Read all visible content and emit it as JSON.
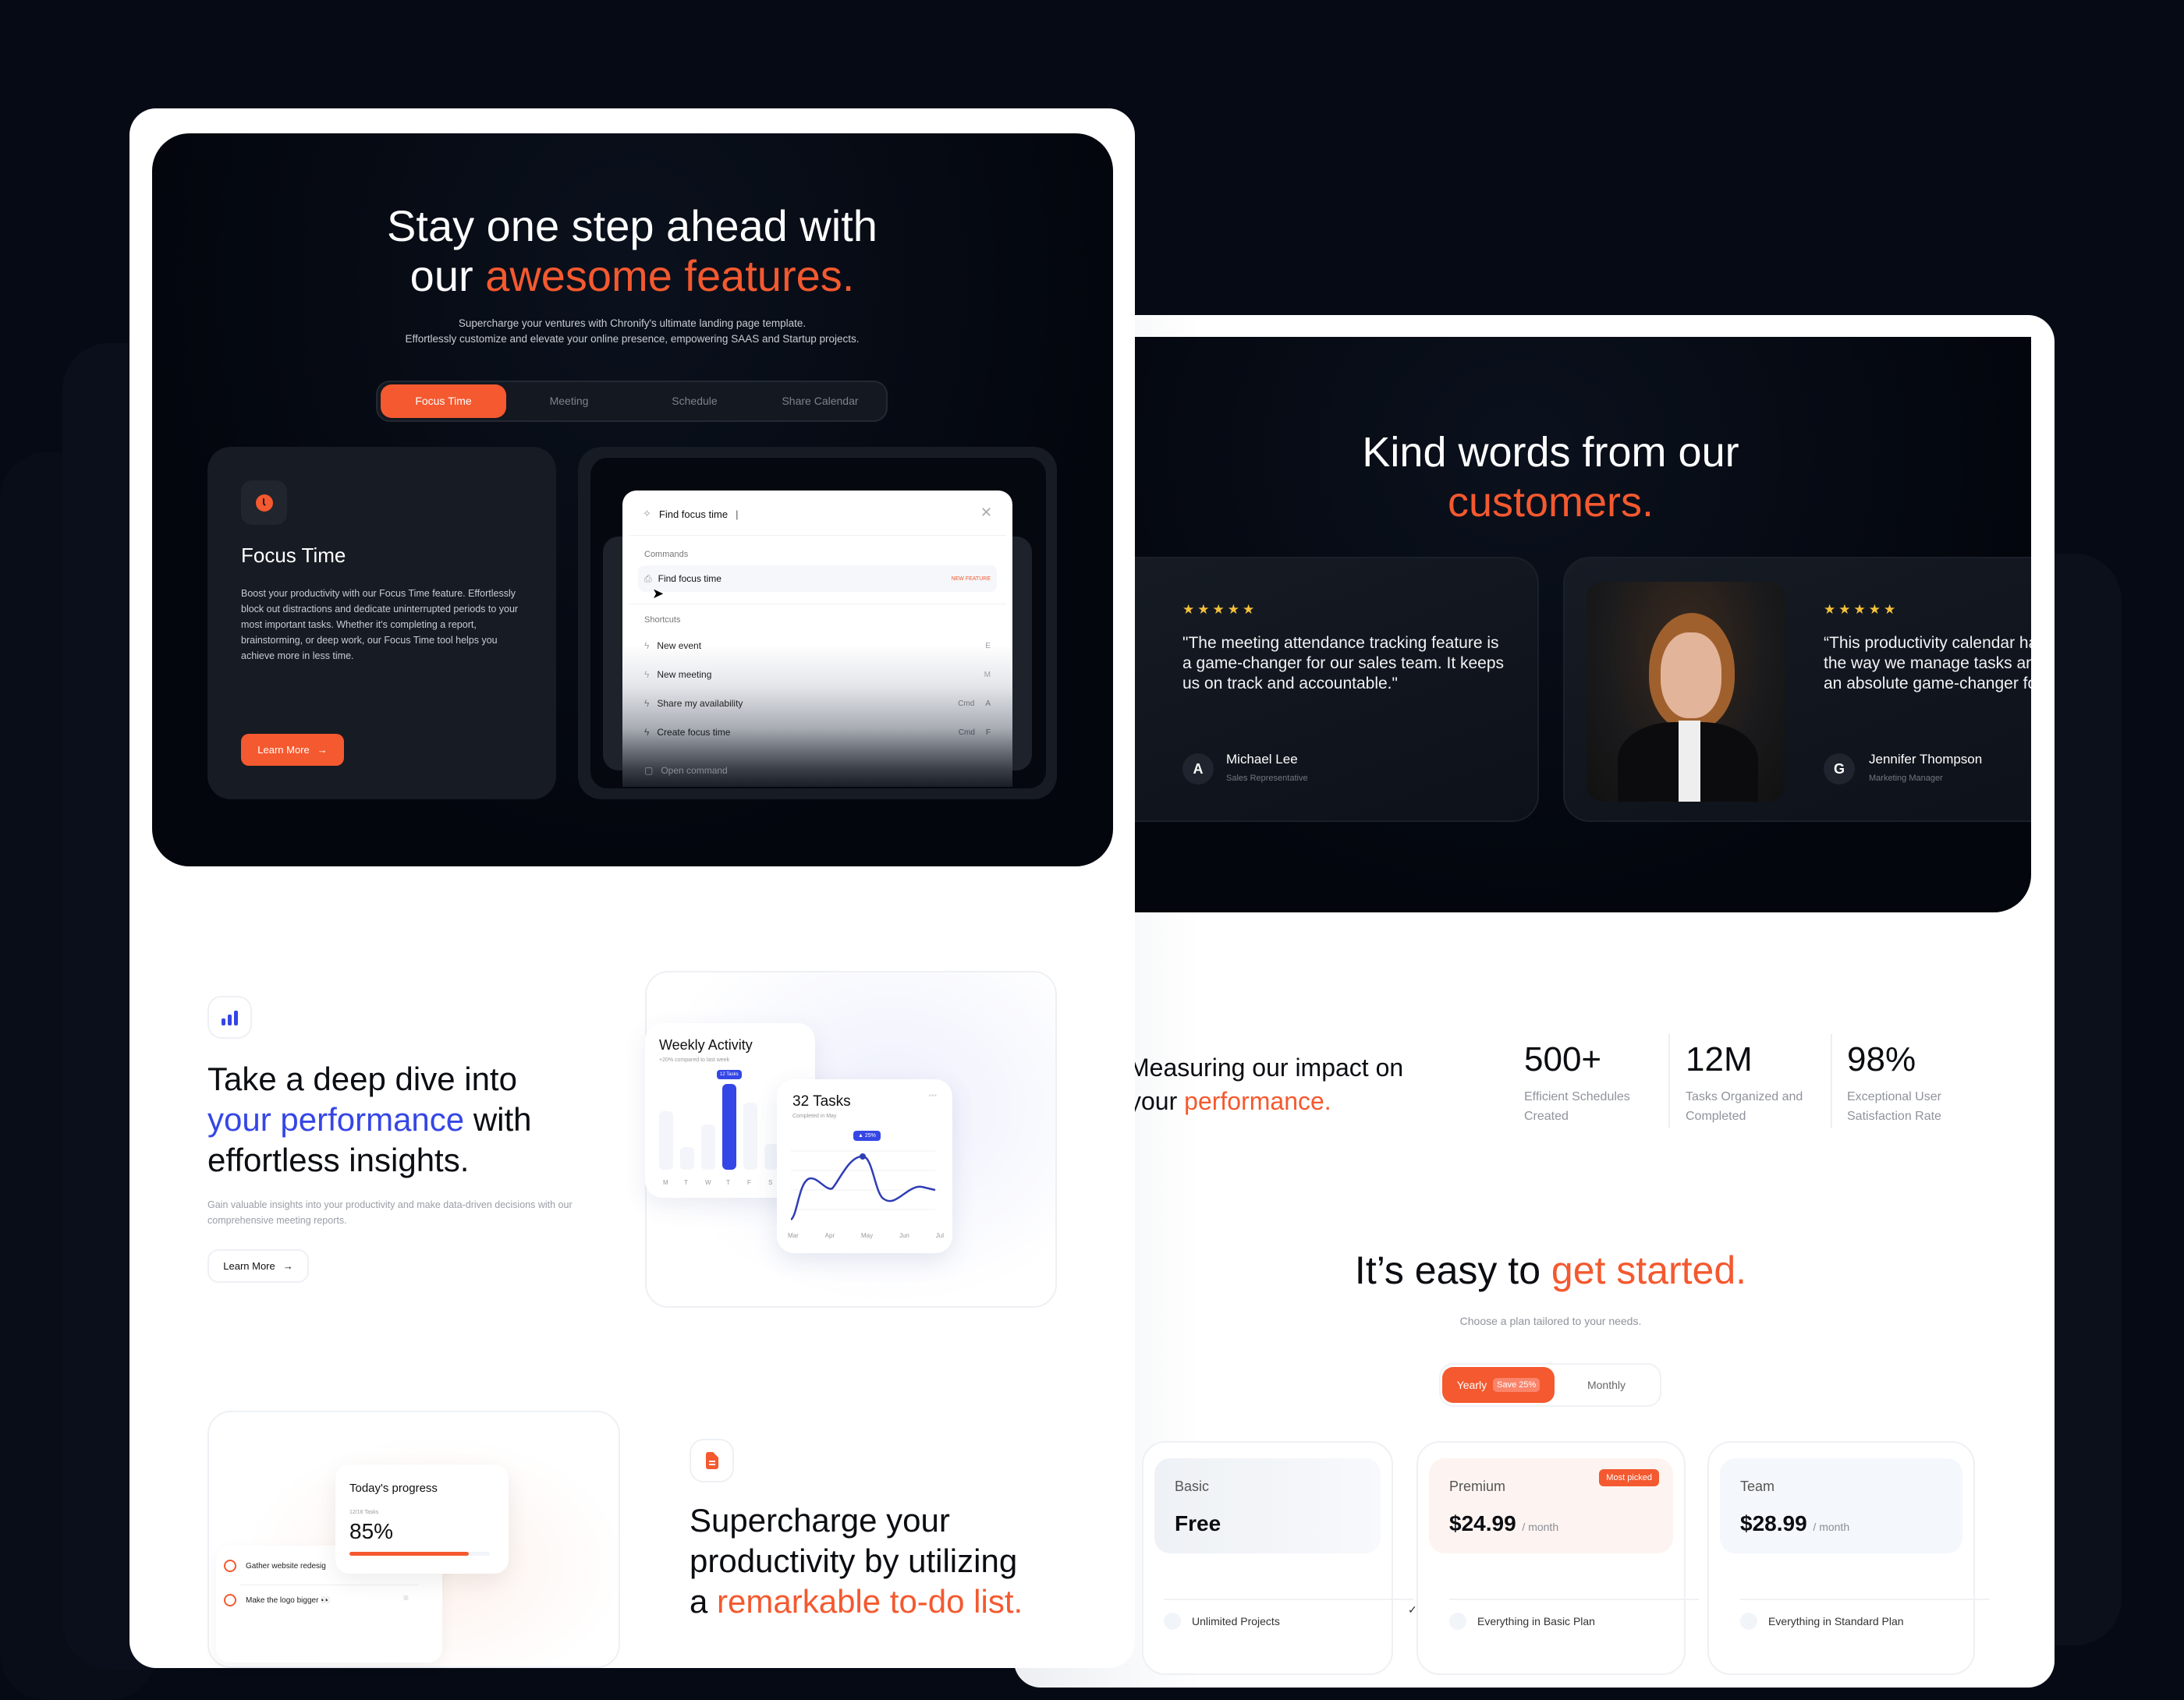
{
  "colors": {
    "accent": "#f4592f",
    "blue": "#3546e6",
    "background": "#050a15"
  },
  "hero": {
    "title_line1": "Stay one step ahead with",
    "title_line2_plain": "our ",
    "title_line2_accent": "awesome features.",
    "subtitle_line1": "Supercharge your ventures with Chronify's ultimate landing page template.",
    "subtitle_line2": "Effortlessly customize and elevate your online presence, empowering SAAS and Startup projects.",
    "tabs": [
      {
        "label": "Focus Time",
        "active": true
      },
      {
        "label": "Meeting"
      },
      {
        "label": "Schedule"
      },
      {
        "label": "Share Calendar"
      }
    ],
    "feature": {
      "icon": "clock-icon",
      "title": "Focus Time",
      "body": "Boost your productivity with our Focus Time feature. Effortlessly block out distractions and dedicate uninterrupted periods to your most important tasks. Whether it's completing a report, brainstorming, or deep work, our Focus Time tool helps you achieve more in less time.",
      "button": "Learn More"
    },
    "command_palette": {
      "search_value": "Find focus time",
      "commands_label": "Commands",
      "command": {
        "label": "Find focus time",
        "badge": "NEW FEATURE"
      },
      "shortcuts_label": "Shortcuts",
      "shortcuts": [
        {
          "label": "New event",
          "keys": [
            "E"
          ]
        },
        {
          "label": "New meeting",
          "keys": [
            "M"
          ]
        },
        {
          "label": "Share my availability",
          "keys": [
            "Cmd",
            "A"
          ]
        },
        {
          "label": "Create focus time",
          "keys": [
            "Cmd",
            "F"
          ]
        },
        {
          "label": "Open command",
          "keys": []
        }
      ]
    }
  },
  "performance": {
    "heading_line1": "Take a deep dive into",
    "heading_accent": "your performance",
    "heading_line2_rest": " with",
    "heading_line3": "effortless insights.",
    "body": "Gain valuable insights into your productivity and make data-driven decisions with our comprehensive meeting reports.",
    "button": "Learn More",
    "weekly": {
      "title": "Weekly Activity",
      "subtitle": "+20% compared to last week",
      "tooltip": "12 Tasks",
      "days": [
        "M",
        "T",
        "W",
        "T",
        "F",
        "S"
      ],
      "values": [
        0.68,
        0.26,
        0.53,
        1.0,
        0.78,
        0.3
      ],
      "active_index": 3
    },
    "monthly": {
      "title": "32 Tasks",
      "subtitle": "Completed in May",
      "badge": "▲ 25%",
      "months": [
        "Mar",
        "Apr",
        "May",
        "Jun",
        "Jul"
      ]
    }
  },
  "todo": {
    "progress_title": "Today's progress",
    "progress_count": "12/16 Tasks",
    "progress_value": "85%",
    "progress_fraction": 0.85,
    "items": [
      "Gather website redesig",
      "Make the logo bigger 👀"
    ],
    "heading_line1": "Supercharge your",
    "heading_line2": "productivity by utilizing",
    "heading_line3_plain": "a ",
    "heading_line3_accent": "remarkable to-do list."
  },
  "testimonials": {
    "heading_line1": "Kind words from our",
    "heading_accent": "customers.",
    "items": [
      {
        "stars": "★★★★★",
        "quote": "\"The meeting attendance tracking feature is a game-changer for our sales team. It keeps us on track and accountable.\"",
        "name": "Michael Lee",
        "role": "Sales Representative",
        "logo": "A"
      },
      {
        "stars": "★★★★★",
        "quote": "“This productivity calendar has revolutionized the way we manage tasks and meetings. It's an absolute game-changer for our team!\"",
        "name": "Jennifer Thompson",
        "role": "Marketing Manager",
        "logo": "G"
      }
    ]
  },
  "impact": {
    "heading_line1": "Measuring our impact on",
    "heading_line2_plain": "your ",
    "heading_accent": "performance.",
    "stats": [
      {
        "value": "500+",
        "label": "Efficient Schedules Created"
      },
      {
        "value": "12M",
        "label": "Tasks Organized and Completed"
      },
      {
        "value": "98%",
        "label": "Exceptional User Satisfaction Rate"
      }
    ]
  },
  "pricing": {
    "heading_plain": "It’s easy to ",
    "heading_accent": "get started.",
    "subtitle": "Choose a plan tailored to your needs.",
    "toggle": {
      "yearly": "Yearly",
      "save": "Save 25%",
      "monthly": "Monthly",
      "selected": "Yearly"
    },
    "plans": [
      {
        "name": "Basic",
        "price": "Free",
        "period": "",
        "feature": "Unlimited Projects"
      },
      {
        "name": "Premium",
        "price": "$24.99",
        "period": "/ month",
        "badge": "Most picked",
        "feature": "Everything in Basic Plan"
      },
      {
        "name": "Team",
        "price": "$28.99",
        "period": "/ month",
        "feature": "Everything in Standard Plan"
      }
    ]
  }
}
